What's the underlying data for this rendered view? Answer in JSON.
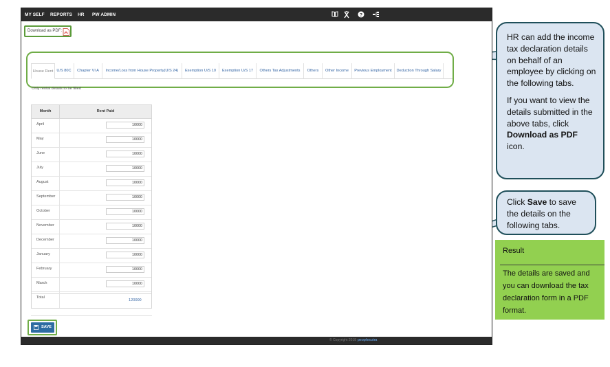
{
  "topbar": {
    "menu": [
      "MY SELF",
      "REPORTS",
      "HR",
      "PW ADMIN"
    ],
    "icons": [
      "book-icon",
      "tools-icon",
      "help-icon",
      "sitemap-icon"
    ]
  },
  "download": {
    "label": "Download as PDF:"
  },
  "tabs": [
    "House Rent",
    "U/S 80C",
    "Chapter VI A",
    "Income/Loss from House Property(U/S 24)",
    "Exemption U/S 10",
    "Exemption U/S 17",
    "Others Tax Adjustments",
    "Others",
    "Other Income",
    "Previous Employment",
    "Deduction Through Salary"
  ],
  "tab_note": "Only rental details to be filled",
  "table": {
    "headers": {
      "month": "Month",
      "rent": "Rent Paid"
    },
    "rows": [
      {
        "month": "April",
        "rent": "10000"
      },
      {
        "month": "May",
        "rent": "10000"
      },
      {
        "month": "June",
        "rent": "10000"
      },
      {
        "month": "July",
        "rent": "10000"
      },
      {
        "month": "August",
        "rent": "10000"
      },
      {
        "month": "September",
        "rent": "10000"
      },
      {
        "month": "October",
        "rent": "10000"
      },
      {
        "month": "November",
        "rent": "10000"
      },
      {
        "month": "December",
        "rent": "10000"
      },
      {
        "month": "January",
        "rent": "10000"
      },
      {
        "month": "February",
        "rent": "10000"
      },
      {
        "month": "March",
        "rent": "10000"
      }
    ],
    "total_label": "Total",
    "total_value": "120000"
  },
  "save": {
    "label": "SAVE"
  },
  "footer": {
    "copyright": "© Copyright 2018",
    "brand": "peoplesutra"
  },
  "callout1": {
    "p1": "HR can add the income tax declaration details on behalf of an employee by clicking on the following tabs.",
    "p2_pre": "If you want to view the details submitted in the above tabs, click ",
    "p2_bold": "Download as PDF",
    "p2_post": " icon."
  },
  "callout2": {
    "pre": "Click ",
    "bold": "Save",
    "post": " to save the details on the following tabs."
  },
  "result": {
    "title": "Result",
    "body": "The details are saved and you can download the tax declaration form in a PDF format."
  },
  "colors": {
    "topbar": "#2b2b2b",
    "highlight": "#70ad47",
    "callout_fill": "#dbe5f1",
    "callout_border": "#1f4f5a",
    "result_fill": "#92d050",
    "save_button": "#2d6ca2",
    "link": "#3465a4"
  }
}
